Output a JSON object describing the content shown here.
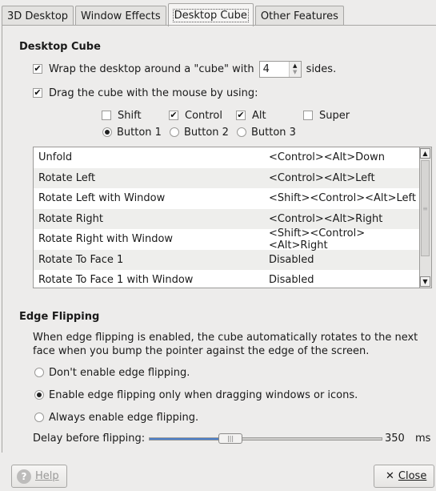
{
  "tabs": [
    {
      "label": "3D Desktop"
    },
    {
      "label": "Window Effects"
    },
    {
      "label": "Desktop Cube"
    },
    {
      "label": "Other Features"
    }
  ],
  "cube": {
    "heading": "Desktop Cube",
    "wrap_prefix": "Wrap the desktop around a \"cube\" with",
    "sides_value": "4",
    "wrap_suffix": "sides.",
    "drag_label": "Drag the cube with the mouse by using:",
    "modifiers": [
      {
        "label": "Shift",
        "checked": false
      },
      {
        "label": "Control",
        "checked": true
      },
      {
        "label": "Alt",
        "checked": true
      },
      {
        "label": "Super",
        "checked": false
      }
    ],
    "buttons": [
      {
        "label": "Button 1",
        "selected": true
      },
      {
        "label": "Button 2",
        "selected": false
      },
      {
        "label": "Button 3",
        "selected": false
      }
    ],
    "shortcuts": [
      {
        "action": "Unfold",
        "keys": "<Control><Alt>Down"
      },
      {
        "action": "Rotate Left",
        "keys": "<Control><Alt>Left"
      },
      {
        "action": "Rotate Left with Window",
        "keys": "<Shift><Control><Alt>Left"
      },
      {
        "action": "Rotate Right",
        "keys": "<Control><Alt>Right"
      },
      {
        "action": "Rotate Right with Window",
        "keys": "<Shift><Control><Alt>Right"
      },
      {
        "action": "Rotate To Face 1",
        "keys": "Disabled"
      },
      {
        "action": "Rotate To Face 1 with Window",
        "keys": "Disabled"
      }
    ]
  },
  "edge": {
    "heading": "Edge Flipping",
    "description": "When edge flipping is enabled, the cube automatically rotates to the next face when you bump the pointer against the edge of the screen.",
    "options": [
      {
        "label": "Don't enable edge flipping.",
        "selected": false
      },
      {
        "label": "Enable edge flipping only when dragging windows or icons.",
        "selected": true
      },
      {
        "label": "Always enable edge flipping.",
        "selected": false
      }
    ],
    "delay_label": "Delay before flipping:",
    "delay_value": "350",
    "delay_unit": "ms",
    "delay_fraction": 0.35
  },
  "footer": {
    "help_label": "Help",
    "close_label": "Close"
  },
  "icons": {
    "check": "checkmark-icon",
    "help": "help-icon",
    "close": "close-icon"
  }
}
